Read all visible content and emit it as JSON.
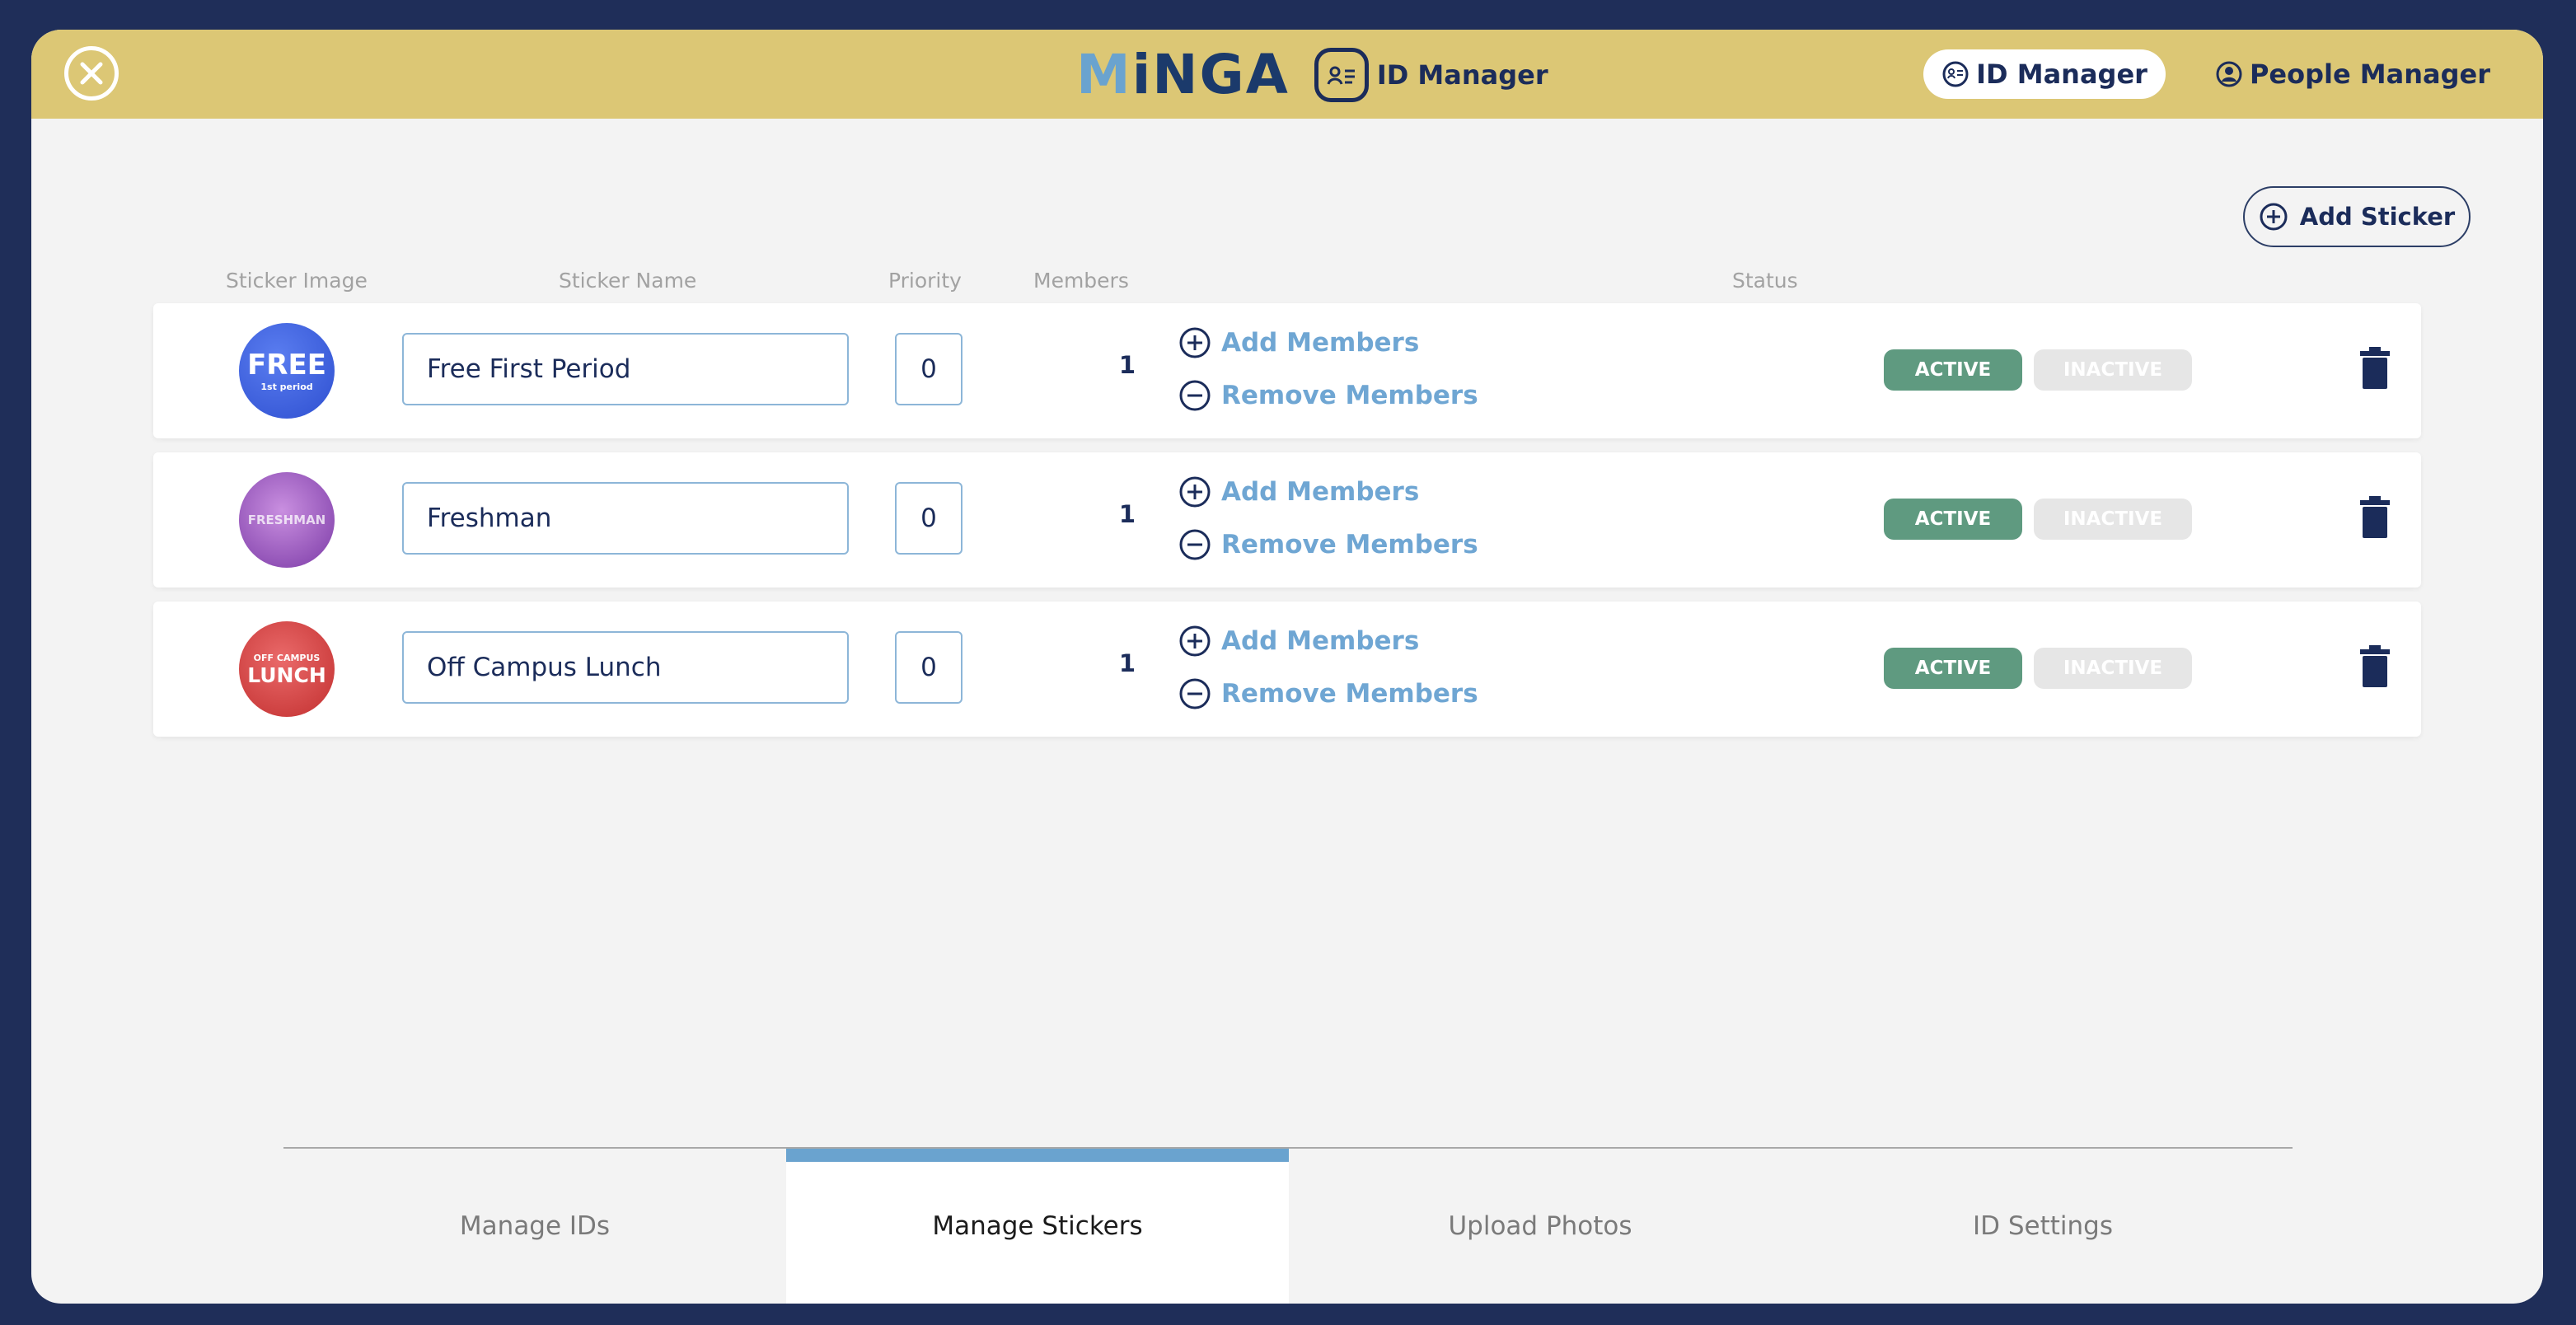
{
  "header": {
    "brand": "MiNGA",
    "module_title": "ID Manager",
    "nav": [
      {
        "label": "ID Manager",
        "active": true,
        "icon": "id-card-icon"
      },
      {
        "label": "People Manager",
        "active": false,
        "icon": "person-circle-icon"
      }
    ]
  },
  "toolbar": {
    "add_sticker_label": "Add Sticker"
  },
  "columns": {
    "image": "Sticker Image",
    "name": "Sticker Name",
    "priority": "Priority",
    "members": "Members",
    "status": "Status"
  },
  "stickers": [
    {
      "image_text": "FREE",
      "image_subtext": "1st period",
      "name": "Free First Period",
      "priority": "0",
      "members": "1",
      "add_label": "Add Members",
      "remove_label": "Remove Members",
      "active_label": "ACTIVE",
      "inactive_label": "INACTIVE",
      "status": "active"
    },
    {
      "image_text": "FRESHMAN",
      "image_subtext": "",
      "name": "Freshman",
      "priority": "0",
      "members": "1",
      "add_label": "Add Members",
      "remove_label": "Remove Members",
      "active_label": "ACTIVE",
      "inactive_label": "INACTIVE",
      "status": "active"
    },
    {
      "image_text": "LUNCH",
      "image_subtext": "OFF CAMPUS",
      "name": "Off Campus Lunch",
      "priority": "0",
      "members": "1",
      "add_label": "Add Members",
      "remove_label": "Remove Members",
      "active_label": "ACTIVE",
      "inactive_label": "INACTIVE",
      "status": "active"
    }
  ],
  "tabs": [
    {
      "label": "Manage IDs",
      "active": false
    },
    {
      "label": "Manage Stickers",
      "active": true
    },
    {
      "label": "Upload Photos",
      "active": false
    },
    {
      "label": "ID Settings",
      "active": false
    }
  ],
  "colors": {
    "background": "#1f2e59",
    "header": "#dcc775",
    "accent": "#6aa3cf",
    "active_status": "#5f9a80"
  }
}
